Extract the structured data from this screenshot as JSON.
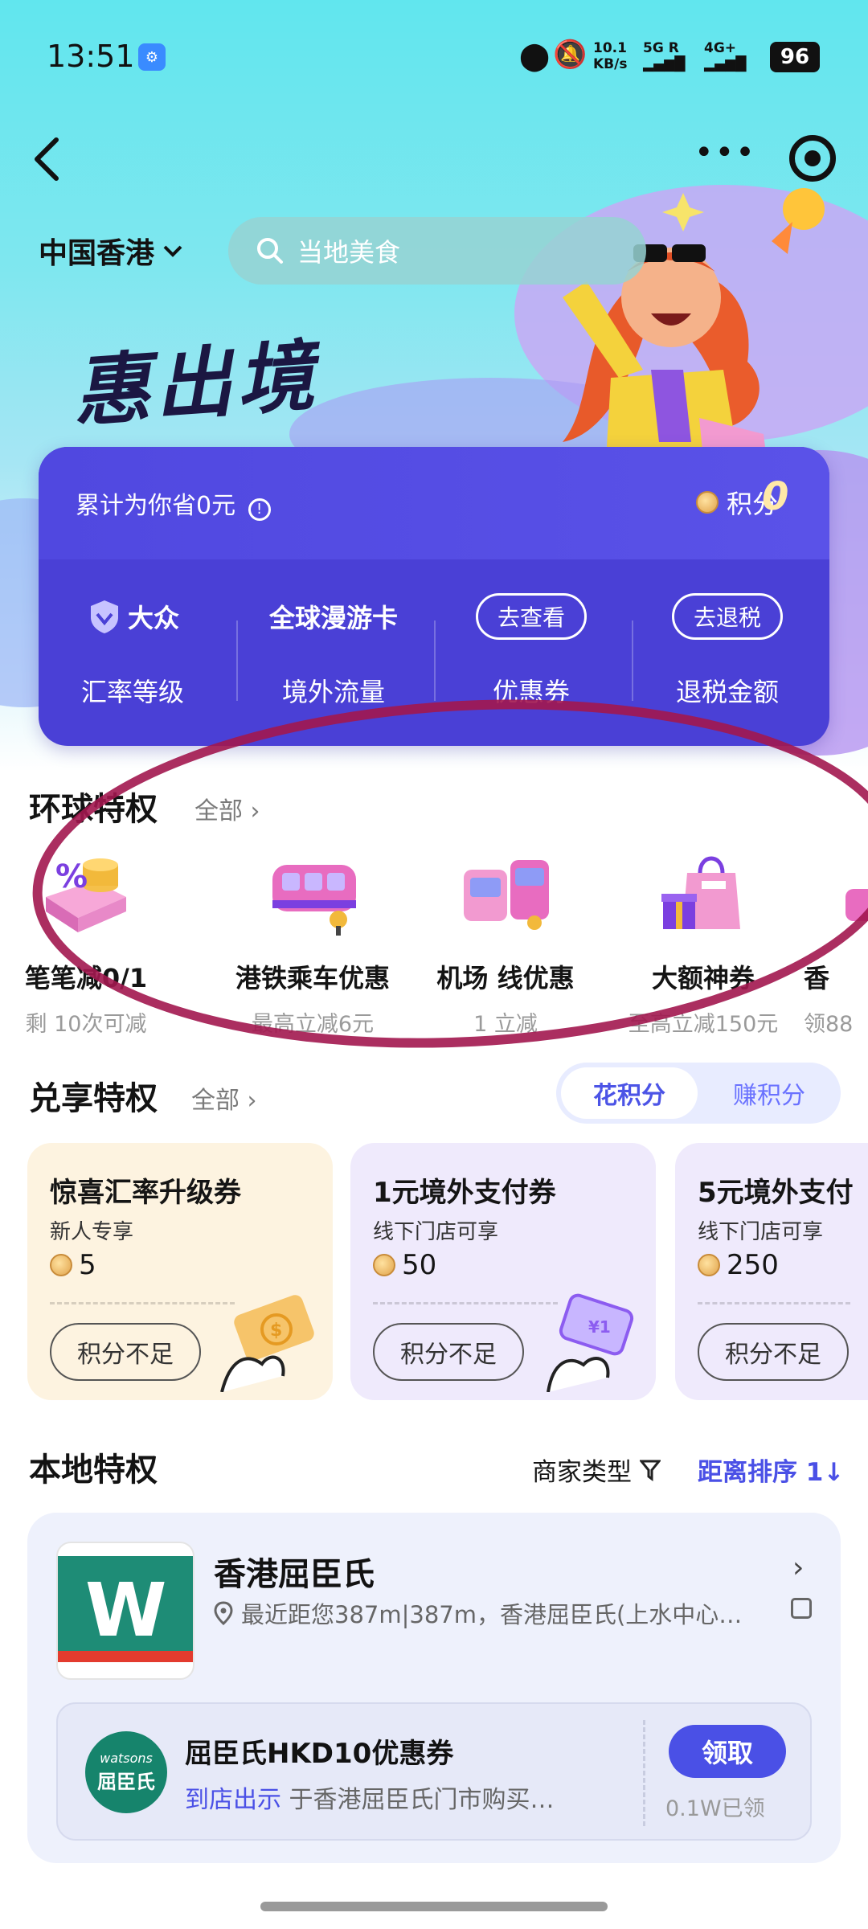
{
  "status_bar": {
    "time": "13:51",
    "net_speed": "10.1 KB/s",
    "signal_5g": "5G R",
    "signal_4g": "4G+",
    "battery": "96"
  },
  "header": {
    "region": "中国香港",
    "search_placeholder": "当地美食",
    "brand_title": "惠出境"
  },
  "stats_card": {
    "saved_text": "累计为你省0元",
    "points_label": "积分",
    "points_value": "0",
    "columns": [
      {
        "top": "大众",
        "label": "汇率等级",
        "kind": "badge"
      },
      {
        "top": "全球漫游卡",
        "label": "境外流量",
        "kind": "text"
      },
      {
        "top": "去查看",
        "label": "优惠券",
        "kind": "pill"
      },
      {
        "top": "去退税",
        "label": "退税金额",
        "kind": "pill"
      }
    ]
  },
  "global_privileges": {
    "title": "环球特权",
    "more": "全部",
    "items": [
      {
        "name": "笔笔减0/1",
        "sub": "剩 10次可减"
      },
      {
        "name": "港铁乘车优惠",
        "sub": "最高立减6元"
      },
      {
        "name": "机场 线优惠",
        "sub": "1 立减"
      },
      {
        "name": "大额神券",
        "sub": "至高立减150元"
      },
      {
        "name": "香",
        "sub": "领88"
      }
    ]
  },
  "points_privileges": {
    "title": "兑享特权",
    "more": "全部",
    "toggle_spend": "花积分",
    "toggle_earn": "赚积分",
    "coupons": [
      {
        "title": "惊喜汇率升级券",
        "sub": "新人专享",
        "cost": "5",
        "button": "积分不足",
        "bg": "#fdf3e0"
      },
      {
        "title": "1元境外支付券",
        "sub": "线下门店可享",
        "cost": "50",
        "button": "积分不足",
        "bg": "#efeafc"
      },
      {
        "title": "5元境外支付",
        "sub": "线下门店可享",
        "cost": "250",
        "button": "积分不足",
        "bg": "#efeafc"
      }
    ]
  },
  "local_privileges": {
    "title": "本地特权",
    "filter_label": "商家类型",
    "sort_label": "距离排序 1↓"
  },
  "merchant": {
    "name": "香港屈臣氏",
    "address": "最近距您387m|387m，香港屈臣氏(上水中心…",
    "logo_letter": "W",
    "voucher": {
      "logo_top": "watsons",
      "logo_bottom": "屈臣氏",
      "title": "屈臣氏HKD10优惠券",
      "desc_accent": "到店出示",
      "desc_rest": "于香港屈臣氏门市购买…",
      "button": "领取",
      "claimed": "0.1W已领"
    }
  },
  "colors": {
    "accent": "#4a50e6",
    "card_purple": "#4a40d6",
    "hero_cyan": "#61e6ee",
    "annotation_red": "#a2174f"
  }
}
